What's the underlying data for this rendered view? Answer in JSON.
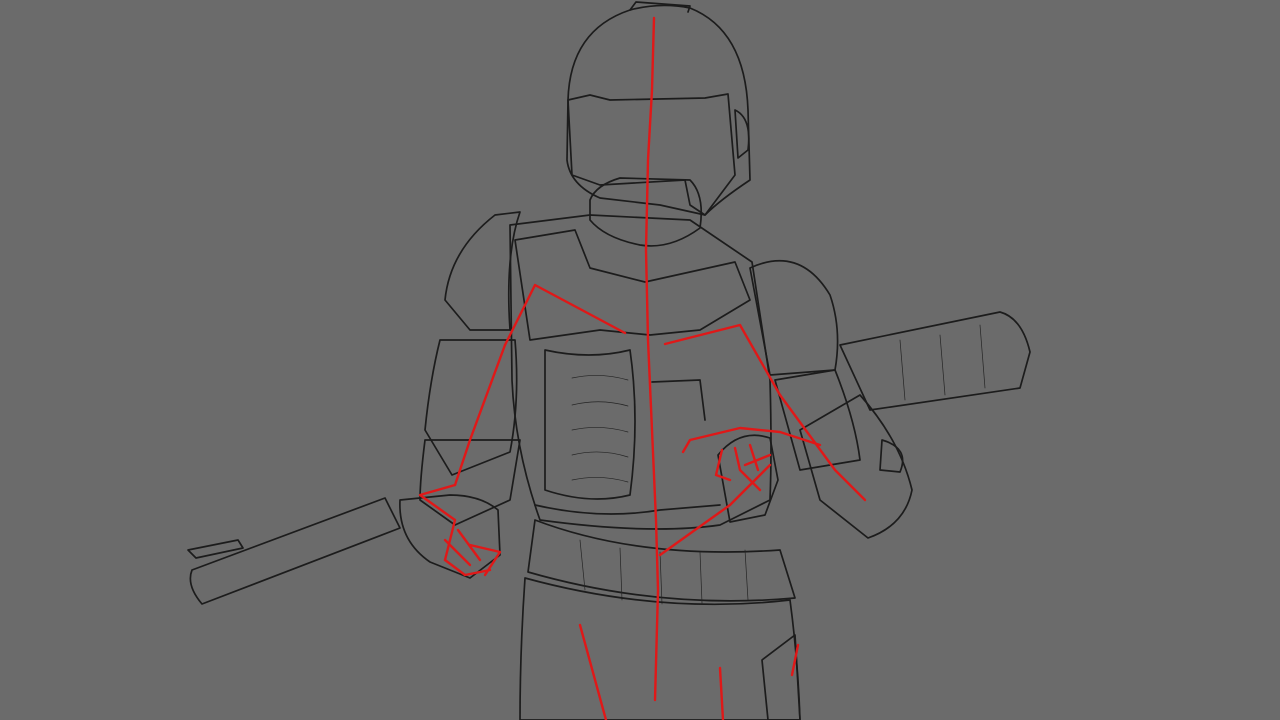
{
  "scene": {
    "background_color": "#6b6b6b",
    "mesh_color": "#1c1c1c",
    "rig_color": "#e01818",
    "display_mode": "wireframe"
  },
  "model": {
    "subject": "armored-trooper",
    "parts": [
      "helmet",
      "neck",
      "torso-back-plate",
      "left-shoulder-pauldron",
      "right-shoulder-pauldron",
      "left-arm",
      "right-arm",
      "left-hand",
      "right-hand",
      "belt",
      "hips",
      "rifle"
    ],
    "rig": {
      "bones": [
        "spine-bone",
        "left-clavicle-bone",
        "right-clavicle-bone",
        "left-upper-arm-bone",
        "right-upper-arm-bone",
        "left-forearm-bone",
        "right-forearm-bone",
        "left-hand-bones",
        "right-hand-bones",
        "pelvis-bone",
        "left-thigh-bone",
        "right-thigh-bone"
      ]
    }
  }
}
